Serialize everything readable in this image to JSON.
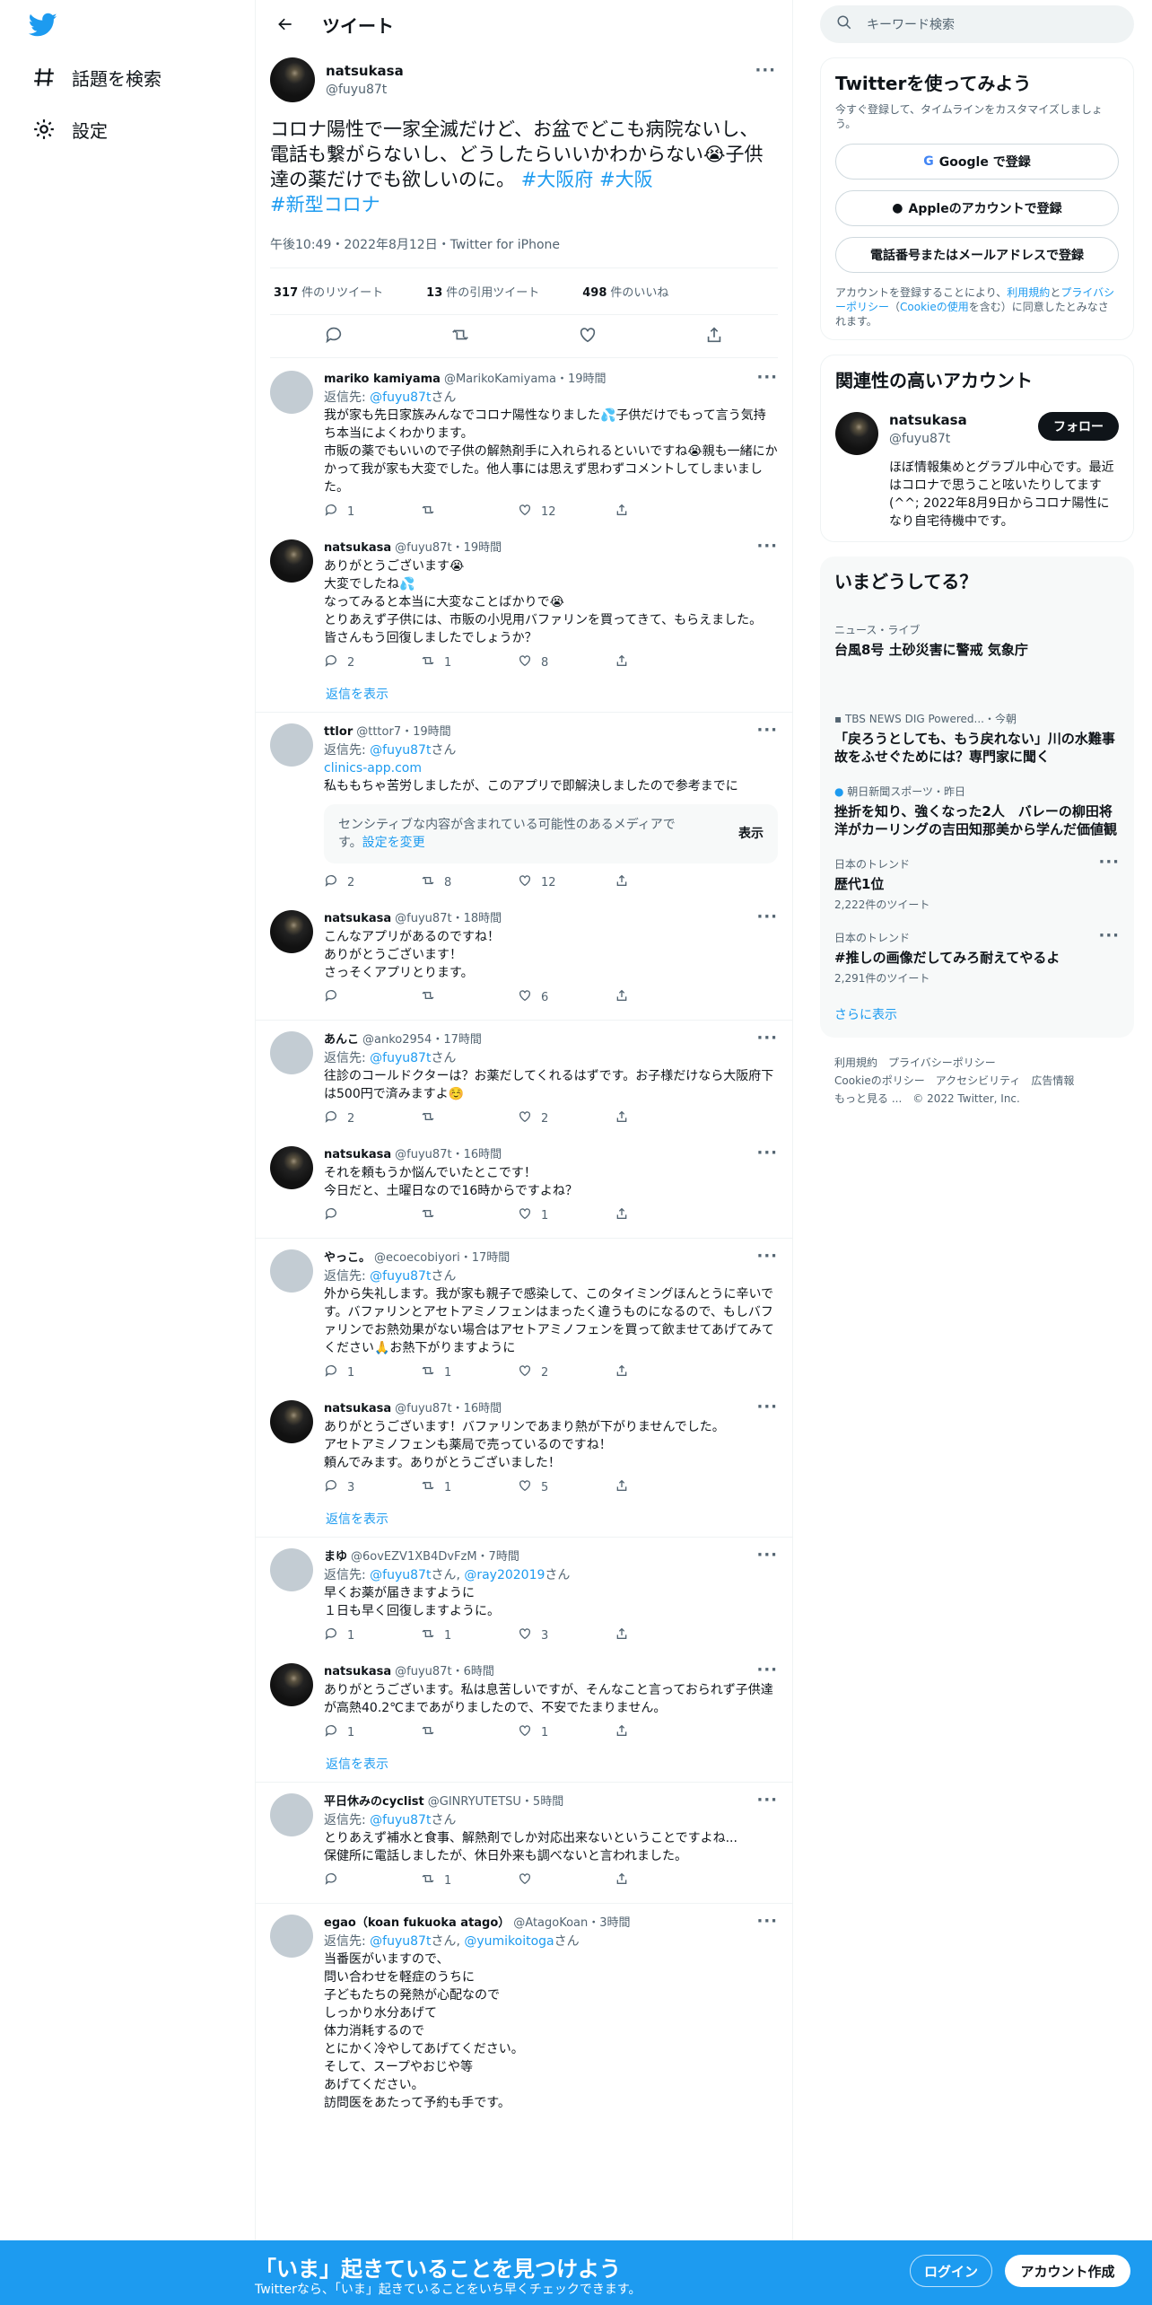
{
  "nav": {
    "explore": "話題を検索",
    "settings": "設定"
  },
  "header": {
    "title": "ツイート"
  },
  "main_tweet": {
    "name": "natsukasa",
    "handle": "@fuyu87t",
    "text_a": "コロナ陽性で一家全滅だけど、お盆でどこも病院ないし、電話も繋がらないし、どうしたらいいかわからない",
    "text_b": "子供達の薬だけでも欲しいのに。",
    "hashtag1": "#大阪府",
    "hashtag2": "#大阪",
    "hashtag3": "#新型コロナ",
    "meta": "午後10:49・2022年8月12日・Twitter for iPhone",
    "retweets": "317",
    "retweets_label": "件のリツイート",
    "quotes": "13",
    "quotes_label": "件の引用ツイート",
    "likes": "498",
    "likes_label": "件のいいね"
  },
  "reply_prefix": "返信先: ",
  "reply_suffix": "さん",
  "show_replies": "返信を表示",
  "replies": [
    {
      "name": "mariko kamiyama",
      "handle": "@MarikoKamiyama",
      "time": "・19時間",
      "to": "@fuyu87t",
      "text": "我が家も先日家族みんなでコロナ陽性なりました💦子供だけでもって言う気持ち本当によくわかります。\n市販の薬でもいいので子供の解熱剤手に入れられるといいですね😭親も一緒にかかって我が家も大変でした。他人事には思えず思わずコメントしてしまいました。",
      "reply": "1",
      "rt": "",
      "like": "12"
    },
    {
      "name": "natsukasa",
      "handle": "@fuyu87t",
      "time": "・19時間",
      "text": "ありがとうございます😭\n大変でしたね💦\nなってみると本当に大変なことばかりで😭\nとりあえず子供には、市販の小児用バファリンを買ってきて、もらえました。\n皆さんもう回復しましたでしょうか？",
      "reply": "2",
      "rt": "1",
      "like": "8"
    },
    {
      "name": "ttlor",
      "handle": "@tttor7",
      "time": "・19時間",
      "to": "@fuyu87t",
      "link": "clinics-app.com",
      "text": "私ももちゃ苦労しましたが、このアプリで即解決しましたので参考までに",
      "sens_text": "センシティブな内容が含まれている可能性のあるメディアです。",
      "sens_link": "設定を変更",
      "sens_btn": "表示",
      "reply": "2",
      "rt": "8",
      "like": "12"
    },
    {
      "name": "natsukasa",
      "handle": "@fuyu87t",
      "time": "・18時間",
      "text": "こんなアプリがあるのですね！\nありがとうございます！\nさっそくアプリとります。",
      "reply": "",
      "rt": "",
      "like": "6"
    },
    {
      "name": "あんこ",
      "handle": "@anko2954",
      "time": "・17時間",
      "to": "@fuyu87t",
      "text": "往診のコールドクターは？お薬だしてくれるはずです。お子様だけなら大阪府下は500円で済みますよ☺️",
      "reply": "2",
      "rt": "",
      "like": "2"
    },
    {
      "name": "natsukasa",
      "handle": "@fuyu87t",
      "time": "・16時間",
      "text": "それを頼もうか悩んでいたとこです！\n今日だと、土曜日なので16時からですよね？",
      "reply": "",
      "rt": "",
      "like": "1"
    },
    {
      "name": "やっこ。",
      "handle": "@ecoecobiyori",
      "time": "・17時間",
      "to": "@fuyu87t",
      "text": "外から失礼します。我が家も親子で感染して、このタイミングほんとうに辛いです。バファリンとアセトアミノフェンはまったく違うものになるので、もしバファリンでお熱効果がない場合はアセトアミノフェンを買って飲ませてあげてみてください🙏お熱下がりますように",
      "reply": "1",
      "rt": "1",
      "like": "2"
    },
    {
      "name": "natsukasa",
      "handle": "@fuyu87t",
      "time": "・16時間",
      "text": "ありがとうございます！バファリンであまり熱が下がりませんでした。\nアセトアミノフェンも薬局で売っているのですね！\n頼んでみます。ありがとうございました！",
      "reply": "3",
      "rt": "1",
      "like": "5"
    },
    {
      "name": "まゆ",
      "handle": "@6ovEZV1XB4DvFzM",
      "time": "・7時間",
      "to": "@fuyu87t",
      "to2": "@ray202019",
      "text": "早くお薬が届きますように\n１日も早く回復しますように。",
      "reply": "1",
      "rt": "1",
      "like": "3"
    },
    {
      "name": "natsukasa",
      "handle": "@fuyu87t",
      "time": "・6時間",
      "text": "ありがとうございます。私は息苦しいですが、そんなこと言っておられず子供達が高熱40.2℃まであがりましたので、不安でたまりません。",
      "reply": "1",
      "rt": "",
      "like": "1"
    },
    {
      "name": "平日休みのcyclist",
      "handle": "@GINRYUTETSU",
      "time": "・5時間",
      "to": "@fuyu87t",
      "text": "とりあえず補水と食事、解熱剤でしか対応出来ないということですよね...\n保健所に電話しましたが、休日外来も調べないと言われました。",
      "reply": "",
      "rt": "1",
      "like": ""
    },
    {
      "name": "egao（koan fukuoka atago）",
      "handle": "@AtagoKoan",
      "time": "・3時間",
      "to": "@fuyu87t",
      "to2": "@yumikoitoga",
      "text": "当番医がいますので、\n問い合わせを軽症のうちに\n子どもたちの発熱が心配なので\nしっかり水分あげて\n体力消耗するので\nとにかく冷やしてあげてください。\nそして、スープやおじや等\nあげてください。\n訪問医をあたって予約も手です。"
    }
  ],
  "right": {
    "search_placeholder": "キーワード検索",
    "signup_title": "Twitterを使ってみよう",
    "signup_sub": "今すぐ登録して、タイムラインをカスタマイズしましょう。",
    "google_btn": "Google で登録",
    "apple_btn": "Appleのアカウントで登録",
    "phone_btn": "電話番号またはメールアドレスで登録",
    "terms_a": "アカウントを登録することにより、",
    "terms_link1": "利用規約",
    "terms_b": "と",
    "terms_link2": "プライバシーポリシー",
    "terms_c": "（",
    "terms_link3": "Cookieの使用",
    "terms_d": "を含む）に同意したとみなされます。",
    "related_title": "関連性の高いアカウント",
    "rel_name": "natsukasa",
    "rel_handle": "@fuyu87t",
    "follow": "フォロー",
    "rel_bio": "ほぼ情報集めとグラブル中心です。最近はコロナで思うこと呟いたりしてます(^^; 2022年8月9日からコロナ陽性になり自宅待機中です。",
    "happening_title": "いまどうしてる？",
    "trends": [
      {
        "cat": "ニュース・ライブ",
        "title": "台風8号 土砂災害に警戒 気象庁"
      },
      {
        "cat": "TBS NEWS DIG Powered...・今朝",
        "title": "「戻ろうとしても、もう戻れない」川の水難事故をふせぐためには？専門家に聞く"
      },
      {
        "cat": "朝日新聞スポーツ・昨日",
        "title": "挫折を知り、強くなった2人　バレーの柳田将洋がカーリングの吉田知那美から学んだ価値観"
      },
      {
        "cat": "日本のトレンド",
        "title": "歴代1位",
        "count": "2,222件のツイート"
      },
      {
        "cat": "日本のトレンド",
        "title": "#推しの画像だしてみろ耐えてやるよ",
        "count": "2,291件のツイート"
      }
    ],
    "show_more": "さらに表示",
    "footer1": "利用規約　プライバシーポリシー",
    "footer2": "Cookieのポリシー　アクセシビリティ　広告情報",
    "footer3": "もっと見る ...　© 2022 Twitter, Inc."
  },
  "bottom": {
    "headline": "「いま」起きていることを見つけよう",
    "sub": "Twitterなら、「いま」起きていることをいち早くチェックできます。",
    "login": "ログイン",
    "signup": "アカウント作成"
  },
  "colors": {
    "accent": "#1d9bf0",
    "text": "#0f1419",
    "muted": "#536471"
  }
}
